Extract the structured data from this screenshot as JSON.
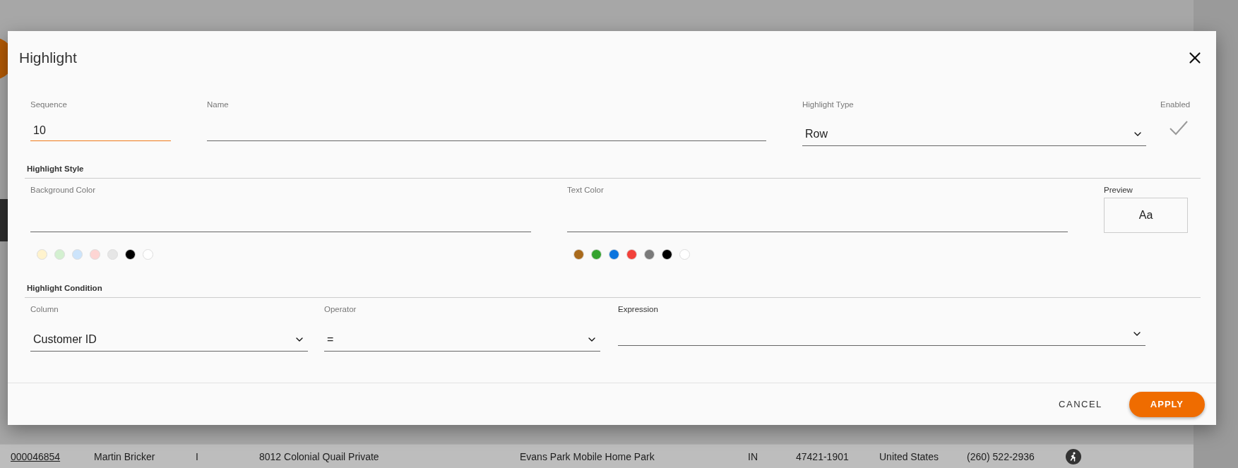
{
  "dialog": {
    "title": "Highlight",
    "sequence": {
      "label": "Sequence",
      "value": "10",
      "focused": true
    },
    "name": {
      "label": "Name",
      "focused": false
    },
    "highlight_type": {
      "label": "Highlight Type",
      "value": "Row"
    },
    "enabled": {
      "label": "Enabled",
      "checked": true
    },
    "highlight_style": {
      "heading": "Highlight Style",
      "background_color": {
        "label": "Background Color",
        "swatches": [
          {
            "color": "#fff3cd"
          },
          {
            "color": "#d3f0d0"
          },
          {
            "color": "#cce4fb"
          },
          {
            "color": "#fdd5d3"
          },
          {
            "color": "#e6e6e6"
          },
          {
            "color": "#000000"
          },
          {
            "color": "#ffffff"
          }
        ]
      },
      "text_color": {
        "label": "Text Color",
        "swatches": [
          {
            "color": "#a96a1c"
          },
          {
            "color": "#35a32f"
          },
          {
            "color": "#0b74de"
          },
          {
            "color": "#f2413a"
          },
          {
            "color": "#7a7a7a"
          },
          {
            "color": "#000000"
          },
          {
            "color": "#ffffff"
          }
        ]
      },
      "preview": {
        "label": "Preview",
        "sample": "Aa"
      }
    },
    "highlight_condition": {
      "heading": "Highlight Condition",
      "column": {
        "label": "Column",
        "value": "Customer ID"
      },
      "operator": {
        "label": "Operator",
        "value": "="
      },
      "expression": {
        "label": "Expression"
      }
    },
    "actions": [
      {
        "label": "CANCEL",
        "kind": "text"
      },
      {
        "label": "APPLY",
        "kind": "primary"
      }
    ]
  },
  "background_table": {
    "rows": [
      {
        "cells": [
          "000046854",
          "Martin Bricker",
          "I",
          "8012 Colonial Quail Private",
          "Evans Park Mobile Home Park",
          "IN",
          "47421-1901",
          "United States",
          "(260) 522-2936"
        ]
      }
    ]
  }
}
